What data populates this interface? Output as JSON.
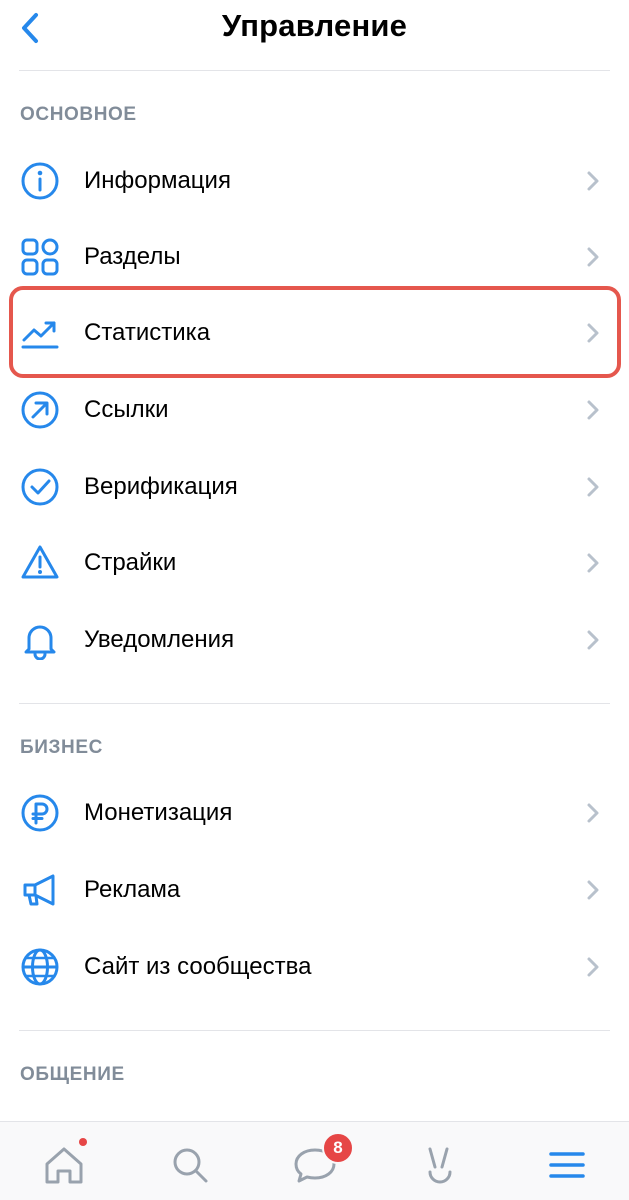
{
  "header": {
    "title": "Управление"
  },
  "sections": {
    "main": {
      "title": "ОСНОВНОЕ",
      "items": [
        {
          "label": "Информация",
          "icon": "info-icon"
        },
        {
          "label": "Разделы",
          "icon": "sections-icon"
        },
        {
          "label": "Статистика",
          "icon": "statistics-icon"
        },
        {
          "label": "Ссылки",
          "icon": "link-icon"
        },
        {
          "label": "Верификация",
          "icon": "verification-icon"
        },
        {
          "label": "Страйки",
          "icon": "warning-icon"
        },
        {
          "label": "Уведомления",
          "icon": "bell-icon"
        }
      ]
    },
    "business": {
      "title": "БИЗНЕС",
      "items": [
        {
          "label": "Монетизация",
          "icon": "ruble-icon"
        },
        {
          "label": "Реклама",
          "icon": "megaphone-icon"
        },
        {
          "label": "Сайт из сообщества",
          "icon": "globe-icon"
        }
      ]
    },
    "communication": {
      "title": "ОБЩЕНИЕ"
    }
  },
  "tabbar": {
    "items": [
      {
        "name": "home",
        "icon": "home-icon",
        "has_dot": true
      },
      {
        "name": "search",
        "icon": "search-icon"
      },
      {
        "name": "messages",
        "icon": "chat-icon",
        "badge": "8"
      },
      {
        "name": "clips",
        "icon": "clips-icon"
      },
      {
        "name": "menu",
        "icon": "menu-icon"
      }
    ]
  },
  "colors": {
    "accent": "#2688eb",
    "secondary_text": "#818c99",
    "chevron": "#b8c1cc",
    "highlight_border": "#e5574d",
    "badge": "#e64646",
    "tab_icon": "#99a2ad"
  }
}
